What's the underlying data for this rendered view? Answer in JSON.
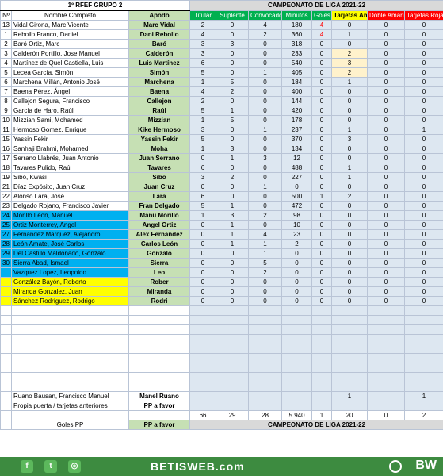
{
  "header": {
    "group_title": "1º RFEF GRUPO 2",
    "competition": "CAMPEONATO  DE LIGA 2021-22"
  },
  "columns": {
    "num": "Nº",
    "name": "Nombre Completo",
    "apodo": "Apodo",
    "titular": "Titular",
    "suplente": "Suplente",
    "convocado": "Convocado",
    "minutos": "Minutos",
    "goles": "Goles",
    "amarillas": "Tarjetas Amarillas",
    "dobles": "Doble Amarillas",
    "rojas": "Tarjetas Rojas"
  },
  "players": [
    {
      "num": "13",
      "name": "Vidal Girona, Marc Vicente",
      "apodo": "Marc Vidal",
      "titular": "2",
      "suplente": "0",
      "convocado": "4",
      "minutos": "180",
      "goles": "4",
      "amarillas": "0",
      "dobles": "0",
      "rojas": "0",
      "style": ""
    },
    {
      "num": "1",
      "name": "Rebollo Franco, Daniel",
      "apodo": "Dani Rebollo",
      "titular": "4",
      "suplente": "0",
      "convocado": "2",
      "minutos": "360",
      "goles": "4",
      "amarillas": "1",
      "dobles": "0",
      "rojas": "0",
      "style": ""
    },
    {
      "num": "2",
      "name": "Baró Ortiz, Marc",
      "apodo": "Baró",
      "titular": "3",
      "suplente": "3",
      "convocado": "0",
      "minutos": "318",
      "goles": "0",
      "amarillas": "0",
      "dobles": "0",
      "rojas": "0",
      "style": ""
    },
    {
      "num": "3",
      "name": "Calderón Portillo, Jose Manuel",
      "apodo": "Calderón",
      "titular": "3",
      "suplente": "0",
      "convocado": "0",
      "minutos": "233",
      "goles": "0",
      "amarillas": "2",
      "dobles": "0",
      "rojas": "0",
      "style": ""
    },
    {
      "num": "4",
      "name": "Martínez de Quel Castiella, Luis",
      "apodo": "Luis Martínez",
      "titular": "6",
      "suplente": "0",
      "convocado": "0",
      "minutos": "540",
      "goles": "0",
      "amarillas": "3",
      "dobles": "0",
      "rojas": "0",
      "style": ""
    },
    {
      "num": "5",
      "name": "Lecea García, Simón",
      "apodo": "Simón",
      "titular": "5",
      "suplente": "0",
      "convocado": "1",
      "minutos": "405",
      "goles": "0",
      "amarillas": "2",
      "dobles": "0",
      "rojas": "0",
      "style": ""
    },
    {
      "num": "6",
      "name": "Marchena Millán, Antonio José",
      "apodo": "Marchena",
      "titular": "1",
      "suplente": "5",
      "convocado": "0",
      "minutos": "184",
      "goles": "0",
      "amarillas": "1",
      "dobles": "0",
      "rojas": "0",
      "style": ""
    },
    {
      "num": "7",
      "name": "Baena Pérez, Ángel",
      "apodo": "Baena",
      "titular": "4",
      "suplente": "2",
      "convocado": "0",
      "minutos": "400",
      "goles": "0",
      "amarillas": "0",
      "dobles": "0",
      "rojas": "0",
      "style": ""
    },
    {
      "num": "8",
      "name": "Callejon Segura, Francisco",
      "apodo": "Callejon",
      "titular": "2",
      "suplente": "0",
      "convocado": "0",
      "minutos": "144",
      "goles": "0",
      "amarillas": "0",
      "dobles": "0",
      "rojas": "0",
      "style": ""
    },
    {
      "num": "9",
      "name": "García de Haro, Raúl",
      "apodo": "Raúl",
      "titular": "5",
      "suplente": "1",
      "convocado": "0",
      "minutos": "420",
      "goles": "0",
      "amarillas": "0",
      "dobles": "0",
      "rojas": "0",
      "style": ""
    },
    {
      "num": "10",
      "name": "Mizzian Sami, Mohamed",
      "apodo": "Mizzian",
      "titular": "1",
      "suplente": "5",
      "convocado": "0",
      "minutos": "178",
      "goles": "0",
      "amarillas": "0",
      "dobles": "0",
      "rojas": "0",
      "style": ""
    },
    {
      "num": "11",
      "name": "Hermoso Gomez, Enrique",
      "apodo": "Kike Hermoso",
      "titular": "3",
      "suplente": "0",
      "convocado": "1",
      "minutos": "237",
      "goles": "0",
      "amarillas": "1",
      "dobles": "0",
      "rojas": "1",
      "style": ""
    },
    {
      "num": "15",
      "name": "Yassin Fekir",
      "apodo": "Yassin Fekir",
      "titular": "5",
      "suplente": "0",
      "convocado": "0",
      "minutos": "370",
      "goles": "0",
      "amarillas": "3",
      "dobles": "0",
      "rojas": "0",
      "style": ""
    },
    {
      "num": "16",
      "name": "Sanhaji Brahmi, Mohamed",
      "apodo": "Moha",
      "titular": "1",
      "suplente": "3",
      "convocado": "0",
      "minutos": "134",
      "goles": "0",
      "amarillas": "0",
      "dobles": "0",
      "rojas": "0",
      "style": ""
    },
    {
      "num": "17",
      "name": "Serrano Llabrés, Juan Antonio",
      "apodo": "Juan Serrano",
      "titular": "0",
      "suplente": "1",
      "convocado": "3",
      "minutos": "12",
      "goles": "0",
      "amarillas": "0",
      "dobles": "0",
      "rojas": "0",
      "style": ""
    },
    {
      "num": "18",
      "name": "Tavares Pulido, Raúl",
      "apodo": "Tavares",
      "titular": "6",
      "suplente": "0",
      "convocado": "0",
      "minutos": "488",
      "goles": "0",
      "amarillas": "1",
      "dobles": "0",
      "rojas": "0",
      "style": ""
    },
    {
      "num": "19",
      "name": "Sibo, Kwasi",
      "apodo": "Sibo",
      "titular": "3",
      "suplente": "2",
      "convocado": "0",
      "minutos": "227",
      "goles": "0",
      "amarillas": "1",
      "dobles": "0",
      "rojas": "0",
      "style": ""
    },
    {
      "num": "21",
      "name": "Díaz Expósito, Juan Cruz",
      "apodo": "Juan Cruz",
      "titular": "0",
      "suplente": "0",
      "convocado": "1",
      "minutos": "0",
      "goles": "0",
      "amarillas": "0",
      "dobles": "0",
      "rojas": "0",
      "style": ""
    },
    {
      "num": "22",
      "name": "Alonso Lara, José",
      "apodo": "Lara",
      "titular": "6",
      "suplente": "0",
      "convocado": "0",
      "minutos": "500",
      "goles": "1",
      "amarillas": "2",
      "dobles": "0",
      "rojas": "0",
      "style": ""
    },
    {
      "num": "23",
      "name": "Delgado Rojano, Francisco Javier",
      "apodo": "Fran Delgado",
      "titular": "5",
      "suplente": "1",
      "convocado": "0",
      "minutos": "472",
      "goles": "0",
      "amarillas": "0",
      "dobles": "0",
      "rojas": "0",
      "style": ""
    },
    {
      "num": "24",
      "name": "Morillo Leon, Manuel",
      "apodo": "Manu Morillo",
      "titular": "1",
      "suplente": "3",
      "convocado": "2",
      "minutos": "98",
      "goles": "0",
      "amarillas": "0",
      "dobles": "0",
      "rojas": "0",
      "style": "blue"
    },
    {
      "num": "25",
      "name": "Ortiz Monterrey, Angel",
      "apodo": "Angel Ortiz",
      "titular": "0",
      "suplente": "1",
      "convocado": "0",
      "minutos": "10",
      "goles": "0",
      "amarillas": "0",
      "dobles": "0",
      "rojas": "0",
      "style": "blue"
    },
    {
      "num": "27",
      "name": "Fernandez Marquez, Alejandro",
      "apodo": "Alex Fernandez",
      "titular": "0",
      "suplente": "1",
      "convocado": "4",
      "minutos": "23",
      "goles": "0",
      "amarillas": "0",
      "dobles": "0",
      "rojas": "0",
      "style": "blue"
    },
    {
      "num": "28",
      "name": "León Amate, José Carlos",
      "apodo": "Carlos León",
      "titular": "0",
      "suplente": "1",
      "convocado": "1",
      "minutos": "2",
      "goles": "0",
      "amarillas": "0",
      "dobles": "0",
      "rojas": "0",
      "style": "blue"
    },
    {
      "num": "29",
      "name": "Del Castillo Maldonado, Gonzalo",
      "apodo": "Gonzalo",
      "titular": "0",
      "suplente": "0",
      "convocado": "1",
      "minutos": "0",
      "goles": "0",
      "amarillas": "0",
      "dobles": "0",
      "rojas": "0",
      "style": "blue"
    },
    {
      "num": "30",
      "name": "Sierra Abad, Ismael",
      "apodo": "Sierra",
      "titular": "0",
      "suplente": "0",
      "convocado": "5",
      "minutos": "0",
      "goles": "0",
      "amarillas": "0",
      "dobles": "0",
      "rojas": "0",
      "style": "blue"
    },
    {
      "num": "",
      "name": "Vazquez Lopez, Leopoldo",
      "apodo": "Leo",
      "titular": "0",
      "suplente": "0",
      "convocado": "2",
      "minutos": "0",
      "goles": "0",
      "amarillas": "0",
      "dobles": "0",
      "rojas": "0",
      "style": "blue"
    },
    {
      "num": "",
      "name": "González Bayón, Roberto",
      "apodo": "Rober",
      "titular": "0",
      "suplente": "0",
      "convocado": "0",
      "minutos": "0",
      "goles": "0",
      "amarillas": "0",
      "dobles": "0",
      "rojas": "0",
      "style": "yellow"
    },
    {
      "num": "",
      "name": "Miranda Gonzalez, Juan",
      "apodo": "Miranda",
      "titular": "0",
      "suplente": "0",
      "convocado": "0",
      "minutos": "0",
      "goles": "0",
      "amarillas": "0",
      "dobles": "0",
      "rojas": "0",
      "style": "yellow"
    },
    {
      "num": "",
      "name": "Sánchez Rodríguez, Rodrigo",
      "apodo": "Rodri",
      "titular": "0",
      "suplente": "0",
      "convocado": "0",
      "minutos": "0",
      "goles": "0",
      "amarillas": "0",
      "dobles": "0",
      "rojas": "0",
      "style": "yellow"
    }
  ],
  "staff": {
    "name": "Ruano Bausan, Francisco Manuel",
    "apodo": "Manel Ruano",
    "amarillas": "1",
    "rojas": "1"
  },
  "own_goals_row": {
    "name": "Propia puerta / tarjetas anteriores",
    "apodo": "PP a favor"
  },
  "totals": {
    "titular": "66",
    "suplente": "29",
    "convocado": "28",
    "minutos": "5.940",
    "goles": "1",
    "amarillas": "20",
    "dobles": "0",
    "rojas": "2"
  },
  "bottom": {
    "label": "Goles PP",
    "apodo": "PP a favor",
    "competition": "CAMPEONATO  DE LIGA 2021-22"
  },
  "footer": {
    "brand": "BETISWEB.com",
    "logo": "BW",
    "icons": [
      "facebook-icon",
      "twitter-icon",
      "instagram-icon"
    ]
  }
}
